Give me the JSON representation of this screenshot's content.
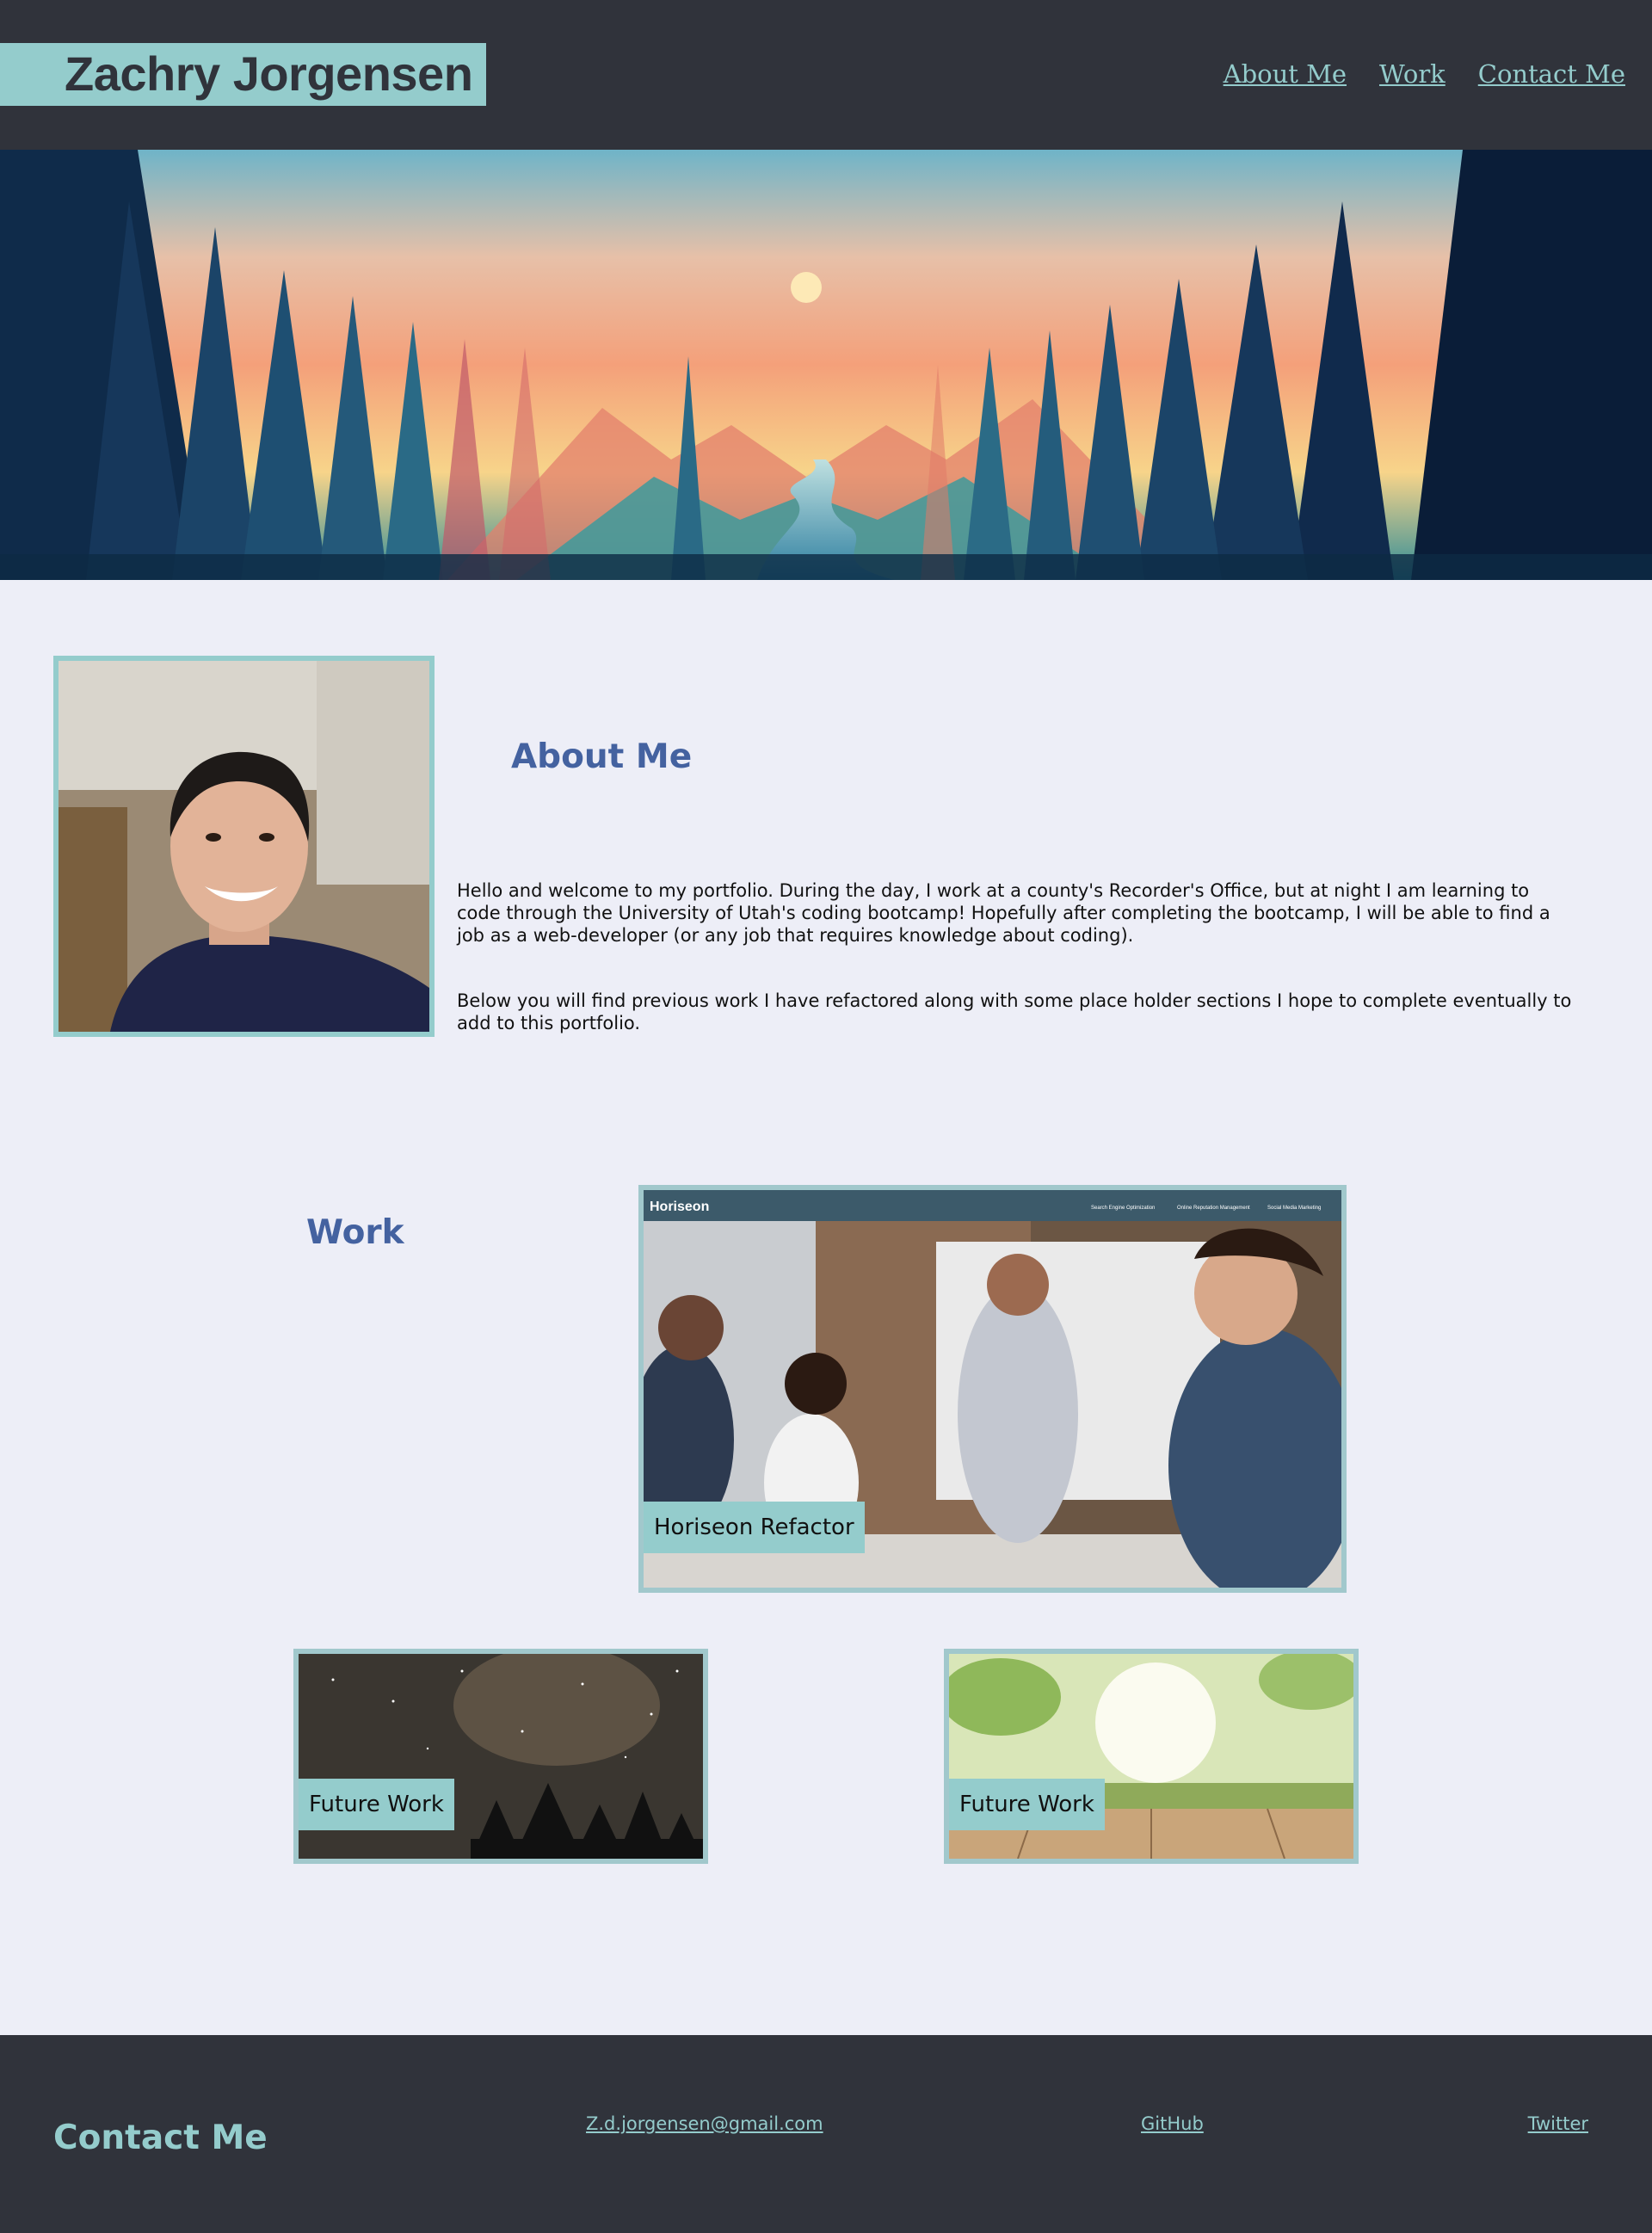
{
  "header": {
    "name": "Zachry Jorgensen",
    "nav": [
      "About Me",
      "Work",
      "Contact Me"
    ]
  },
  "about": {
    "title": "About Me",
    "paragraph_1": "Hello and welcome to my portfolio. During the day, I work at a county's Recorder's Office, but at night I am learning to code through the University of Utah's coding bootcamp! Hopefully after completing the bootcamp, I will be able to find a job as a web-developer (or any job that requires knowledge about coding).",
    "paragraph_2": "Below you will find previous work I have refactored along with some place holder sections I hope to complete eventually to add to this portfolio."
  },
  "work": {
    "title": "Work",
    "main_project": {
      "label": "Horiseon Refactor",
      "screenshot_brand": "Horiseon",
      "screenshot_nav": [
        "Search Engine Optimization",
        "Online Reputation Management",
        "Social Media Marketing"
      ]
    },
    "future_1": {
      "label": "Future Work"
    },
    "future_2": {
      "label": "Future Work"
    }
  },
  "footer": {
    "title": "Contact Me",
    "email": "Z.d.jorgensen@gmail.com",
    "github": "GitHub",
    "twitter": "Twitter"
  },
  "colors": {
    "dark": "#30333b",
    "accent": "#94cccc",
    "heading": "#4462a0",
    "background": "#edeef7"
  }
}
